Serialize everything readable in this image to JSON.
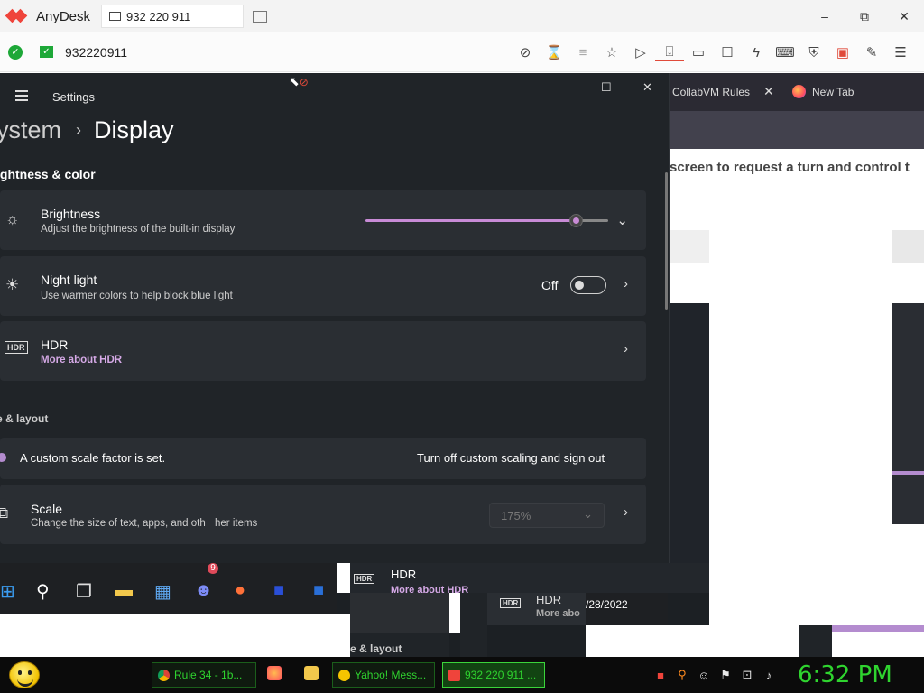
{
  "anydesk": {
    "app_name": "AnyDesk",
    "tab_label": "932 220 911",
    "connection_id": "932220911",
    "brand_color": "#ef443b",
    "status_color": "#1ea838",
    "window_controls": {
      "minimize": "–",
      "restore": "⧉",
      "close": "✕"
    },
    "toolbar_icons": [
      "monitor-crossed-icon",
      "hourglass-icon",
      "database-icon",
      "star-icon",
      "file-transfer-icon",
      "remote-input-icon",
      "display-icon",
      "chat-icon",
      "lightning-icon",
      "keyboard-icon",
      "privacy-icon",
      "record-icon",
      "pen-icon",
      "menu-icon"
    ]
  },
  "browser": {
    "tab1": "CollabVM Rules",
    "tab1_close": "✕",
    "tab2": "New Tab",
    "page_text": "screen to request a turn and control t"
  },
  "settings": {
    "app_title": "Settings",
    "window_controls": {
      "minimize": "–",
      "maximize": "☐",
      "close": "✕"
    },
    "breadcrumb_parent": "ystem",
    "breadcrumb_sep": "›",
    "breadcrumb_current": "Display",
    "section_brightness": "ightness & color",
    "brightness": {
      "title": "Brightness",
      "subtitle": "Adjust the brightness of the built-in display",
      "value_fraction": 0.86
    },
    "night_light": {
      "title": "Night light",
      "subtitle": "Use warmer colors to help block blue light",
      "state": "Off"
    },
    "hdr": {
      "title": "HDR",
      "link": "More about HDR"
    },
    "section_scale": "e & layout",
    "custom_scale": {
      "text": "A custom scale factor is set.",
      "action": "Turn off custom scaling and sign out"
    },
    "scale": {
      "title": "Scale",
      "subtitle": "Change the size of text, apps, and oth",
      "subtitle_overlap": "her items",
      "value": "175%"
    },
    "accent_color": "#c88bd6"
  },
  "remote_artifacts": {
    "hdr_title": "HDR",
    "hdr_link": "More about HDR",
    "hdr_title2": "HDR",
    "hdr_link2": "More abo",
    "date_fragment": "/28/2022",
    "layout_fragment": "e & layout",
    "discord_badge": "9"
  },
  "host_taskbar": {
    "buttons": [
      {
        "label": "Rule 34 - 1b...",
        "icon": "chrome-icon"
      },
      {
        "label": "Yahoo! Mess...",
        "icon": "yahoo-messenger-icon"
      },
      {
        "label": "932 220 911 ...",
        "icon": "anydesk-icon"
      }
    ],
    "clock": "6:32 PM",
    "clock_color": "#2fd42f"
  }
}
